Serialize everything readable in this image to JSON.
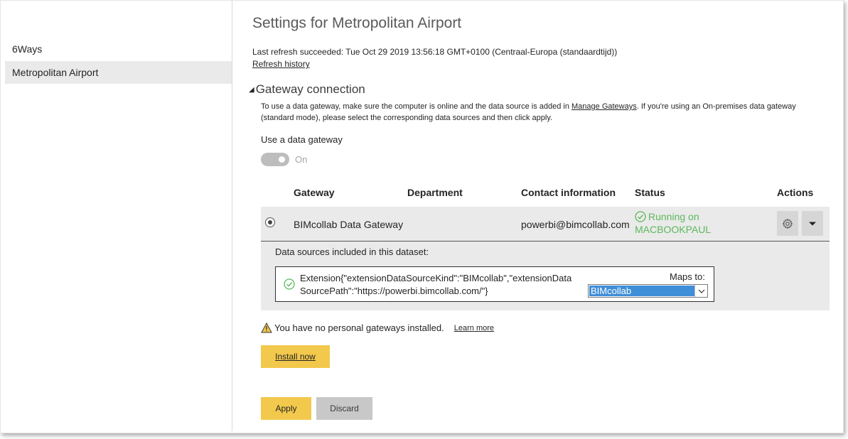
{
  "sidebar": {
    "items": [
      {
        "label": "6Ways",
        "selected": false
      },
      {
        "label": "Metropolitan Airport",
        "selected": true
      }
    ]
  },
  "header": {
    "title": "Settings for Metropolitan Airport",
    "last_refresh": "Last refresh succeeded: Tue Oct 29 2019 13:56:18 GMT+0100 (Centraal-Europa (standaardtijd))",
    "refresh_history_link": "Refresh history"
  },
  "gateway_section": {
    "heading": "Gateway connection",
    "description_pre": "To use a data gateway, make sure the computer is online and the data source is added in ",
    "description_link": "Manage Gateways",
    "description_post": ". If you're using an On-premises data gateway (standard mode), please select the corresponding data sources and then click apply.",
    "use_gateway_label": "Use a data gateway",
    "toggle_label": "On",
    "table": {
      "headers": {
        "gateway": "Gateway",
        "department": "Department",
        "contact": "Contact information",
        "status": "Status",
        "actions": "Actions"
      },
      "row": {
        "gateway": "BIMcollab Data Gateway",
        "department": "",
        "contact": "powerbi@bimcollab.com",
        "status_line1": "Running on",
        "status_line2": "MACBOOKPAUL"
      }
    },
    "data_sources": {
      "title": "Data sources included in this dataset:",
      "source_text": "Extension{\"extensionDataSourceKind\":\"BIMcollab\",\"extensionDataSourcePath\":\"https://powerbi.bimcollab.com/\"}",
      "maps_to_label": "Maps to:",
      "maps_to_value": "BIMcollab"
    },
    "warning_text": "You have no personal gateways installed.",
    "learn_more": "Learn more",
    "install_button": "Install now"
  },
  "actions": {
    "apply": "Apply",
    "discard": "Discard"
  },
  "colors": {
    "accent_yellow": "#f2c94c",
    "status_green": "#5cb85c",
    "select_blue": "#3f8ed8",
    "row_gray": "#eaeaea"
  }
}
